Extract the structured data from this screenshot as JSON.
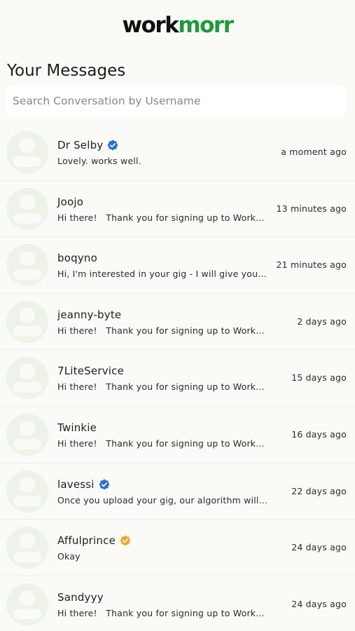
{
  "brand": {
    "logo_part1": "work",
    "logo_part2": "morr",
    "color_dark": "#111111",
    "color_green": "#1f9a3c"
  },
  "page": {
    "title": "Your Messages"
  },
  "search": {
    "placeholder": "Search Conversation by Username",
    "value": ""
  },
  "badge_colors": {
    "blue": "#2d6fcf",
    "gold": "#f0a830"
  },
  "conversations": [
    {
      "username": "Dr Selby",
      "verified": "blue",
      "preview": "Lovely. works well.",
      "time": "a moment ago"
    },
    {
      "username": "Joojo",
      "verified": "none",
      "preview": "Hi there!   Thank you for signing up to Workmorr :)",
      "time": "13 minutes ago"
    },
    {
      "username": "boqyno",
      "verified": "none",
      "preview": "Hi, I'm interested in your gig - I will give you a quote",
      "time": "21 minutes ago"
    },
    {
      "username": "jeanny-byte",
      "verified": "none",
      "preview": "Hi there!   Thank you for signing up to Workmorr :)",
      "time": "2 days ago"
    },
    {
      "username": "7LiteService",
      "verified": "none",
      "preview": "Hi there!   Thank you for signing up to Workmorr :)",
      "time": "15 days ago"
    },
    {
      "username": "Twinkie",
      "verified": "none",
      "preview": "Hi there!   Thank you for signing up to Workmorr :)",
      "time": "16 days ago"
    },
    {
      "username": "lavessi",
      "verified": "blue",
      "preview": "Once you upload your gig, our algorithm will allow buyers",
      "time": "22 days ago"
    },
    {
      "username": "Affulprince",
      "verified": "gold",
      "preview": "Okay",
      "time": "24 days ago"
    },
    {
      "username": "Sandyyy",
      "verified": "none",
      "preview": "Hi there!   Thank you for signing up to Workmorr :)",
      "time": "24 days ago"
    }
  ]
}
